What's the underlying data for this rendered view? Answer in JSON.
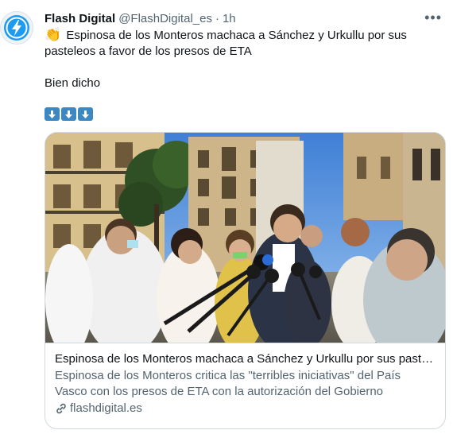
{
  "tweet": {
    "author_name": "Flash Digital",
    "handle": "@FlashDigital_es",
    "separator": "·",
    "time": "1h",
    "more_label": "•••",
    "text_line1": "Espinosa de los Monteros machaca a Sánchez y Urkullu por sus",
    "text_line2": "pasteleos a favor de los presos de ETA",
    "text_line3": "Bien dicho",
    "emoji": "👏",
    "arrow_count": 3,
    "arrow_color": "#3b88c3",
    "accent": "#1d9bf0"
  },
  "card": {
    "title": "Espinosa de los Monteros machaca a Sánchez y Urkullu por sus pasteleos a favor de los presos de ETA",
    "desc_line1": "Espinosa de los Monteros critica las \"terribles iniciativas\" del País",
    "desc_line2": "Vasco con los presos de ETA con la autorización del Gobierno",
    "domain": "flashdigital.es"
  }
}
